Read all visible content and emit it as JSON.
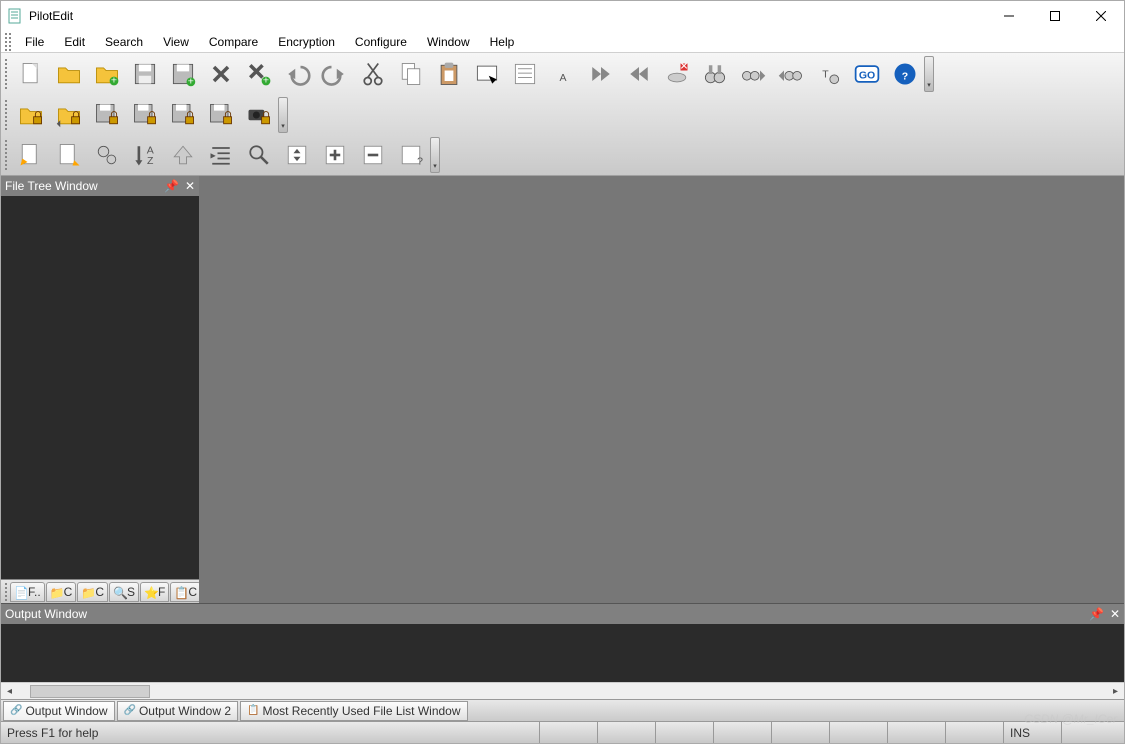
{
  "titlebar": {
    "title": "PilotEdit"
  },
  "menu": [
    "File",
    "Edit",
    "Search",
    "View",
    "Compare",
    "Encryption",
    "Configure",
    "Window",
    "Help"
  ],
  "toolbar1": [
    {
      "name": "new-file-icon",
      "type": "newfile"
    },
    {
      "name": "open-folder-icon",
      "type": "folder"
    },
    {
      "name": "open-folder-plus-icon",
      "type": "folderplus"
    },
    {
      "name": "save-icon",
      "type": "disk"
    },
    {
      "name": "save-all-icon",
      "type": "diskplus"
    },
    {
      "name": "close-x-icon",
      "type": "x"
    },
    {
      "name": "close-all-x-icon",
      "type": "xplus"
    },
    {
      "name": "undo-icon",
      "type": "undo"
    },
    {
      "name": "redo-icon",
      "type": "redo"
    },
    {
      "name": "cut-icon",
      "type": "cut"
    },
    {
      "name": "copy-icon",
      "type": "copy"
    },
    {
      "name": "paste-icon",
      "type": "paste"
    },
    {
      "name": "select-icon",
      "type": "selrect"
    },
    {
      "name": "list-icon",
      "type": "list"
    },
    {
      "name": "font-icon",
      "type": "A"
    },
    {
      "name": "next-double-icon",
      "type": "dright"
    },
    {
      "name": "prev-double-icon",
      "type": "dleft"
    },
    {
      "name": "cancel-net-icon",
      "type": "netx"
    },
    {
      "name": "find-icon",
      "type": "binoc"
    },
    {
      "name": "find-next-icon",
      "type": "binocright"
    },
    {
      "name": "find-prev-icon",
      "type": "binocleft"
    },
    {
      "name": "text-tool-icon",
      "type": "Tgear"
    },
    {
      "name": "go-icon",
      "type": "go"
    },
    {
      "name": "help-icon",
      "type": "help"
    }
  ],
  "toolbar2": [
    {
      "name": "lock-folder-icon",
      "type": "folderlock"
    },
    {
      "name": "lock-folder2-icon",
      "type": "folderlock2"
    },
    {
      "name": "lock-disk-icon",
      "type": "disklock"
    },
    {
      "name": "lock-disk2-icon",
      "type": "disklock"
    },
    {
      "name": "lock-disk3-icon",
      "type": "disklock"
    },
    {
      "name": "lock-disk4-icon",
      "type": "disklock"
    },
    {
      "name": "camera-lock-icon",
      "type": "camlock"
    }
  ],
  "toolbar3": [
    {
      "name": "reload-page-icon",
      "type": "pagestar"
    },
    {
      "name": "reload-page2-icon",
      "type": "pagestar2"
    },
    {
      "name": "gears-icon",
      "type": "gears"
    },
    {
      "name": "sort-az-icon",
      "type": "sortaz"
    },
    {
      "name": "up-arrow-icon",
      "type": "up"
    },
    {
      "name": "indent-icon",
      "type": "indent"
    },
    {
      "name": "zoom-icon",
      "type": "zoom"
    },
    {
      "name": "collapse-icon",
      "type": "updown"
    },
    {
      "name": "plus-box-icon",
      "type": "plus"
    },
    {
      "name": "minus-box-icon",
      "type": "minus"
    },
    {
      "name": "box-q-icon",
      "type": "boxq"
    }
  ],
  "panels": {
    "file_tree_title": "File Tree Window",
    "output_title": "Output Window"
  },
  "file_tree_tabs": [
    "F..",
    "C",
    "C",
    "S",
    "F",
    "C"
  ],
  "output_tabs": [
    "Output Window",
    "Output Window 2",
    "Most Recently Used File List Window"
  ],
  "status": {
    "help": "Press F1 for help",
    "mode": "INS"
  },
  "watermark": "CSDN @Mr_ICer"
}
